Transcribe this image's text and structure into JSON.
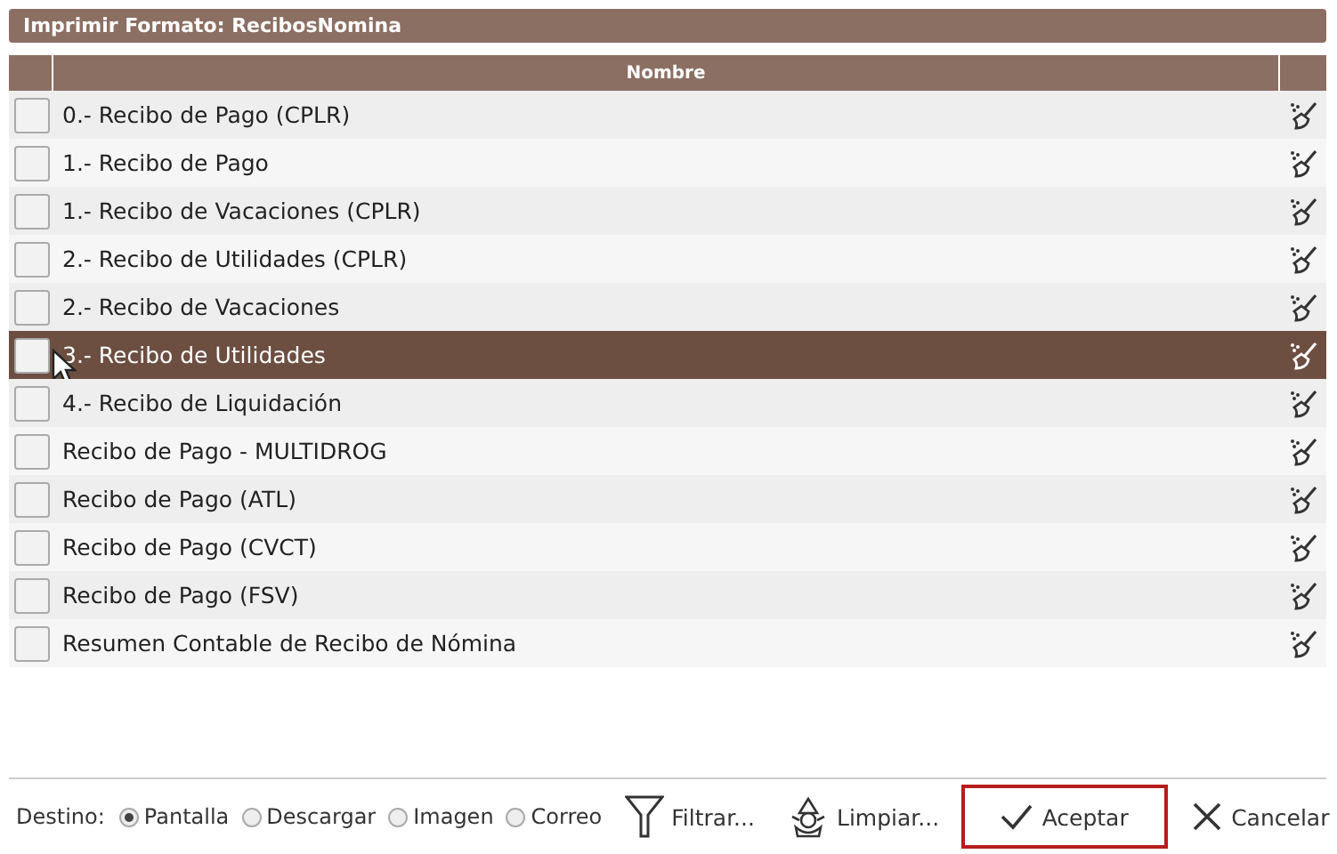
{
  "window": {
    "title": "Imprimir Formato: RecibosNomina"
  },
  "table": {
    "columns": [
      "Nombre"
    ],
    "rows": [
      {
        "name": "0.- Recibo de Pago (CPLR)",
        "checked": false,
        "selected": false
      },
      {
        "name": "1.- Recibo de Pago",
        "checked": false,
        "selected": false
      },
      {
        "name": "1.- Recibo de Vacaciones (CPLR)",
        "checked": false,
        "selected": false
      },
      {
        "name": "2.- Recibo de Utilidades (CPLR)",
        "checked": false,
        "selected": false
      },
      {
        "name": "2.- Recibo de Vacaciones",
        "checked": false,
        "selected": false
      },
      {
        "name": "3.- Recibo de Utilidades",
        "checked": false,
        "selected": true
      },
      {
        "name": "4.- Recibo de Liquidación",
        "checked": false,
        "selected": false
      },
      {
        "name": "Recibo de Pago - MULTIDROG",
        "checked": false,
        "selected": false
      },
      {
        "name": "Recibo de Pago (ATL)",
        "checked": false,
        "selected": false
      },
      {
        "name": "Recibo de Pago (CVCT)",
        "checked": false,
        "selected": false
      },
      {
        "name": "Recibo de Pago (FSV)",
        "checked": false,
        "selected": false
      },
      {
        "name": "Resumen Contable de Recibo de Nómina",
        "checked": false,
        "selected": false
      }
    ]
  },
  "footer": {
    "destination_label": "Destino:",
    "destinations": [
      {
        "label": "Pantalla",
        "selected": true
      },
      {
        "label": "Descargar",
        "selected": false
      },
      {
        "label": "Imagen",
        "selected": false
      },
      {
        "label": "Correo",
        "selected": false
      }
    ],
    "buttons": [
      {
        "kind": "filter",
        "label": "Filtrar...",
        "focused": false
      },
      {
        "kind": "clean",
        "label": "Limpiar...",
        "focused": false
      },
      {
        "kind": "accept",
        "label": "Aceptar",
        "focused": true
      },
      {
        "kind": "cancel",
        "label": "Cancelar",
        "focused": false
      }
    ]
  }
}
